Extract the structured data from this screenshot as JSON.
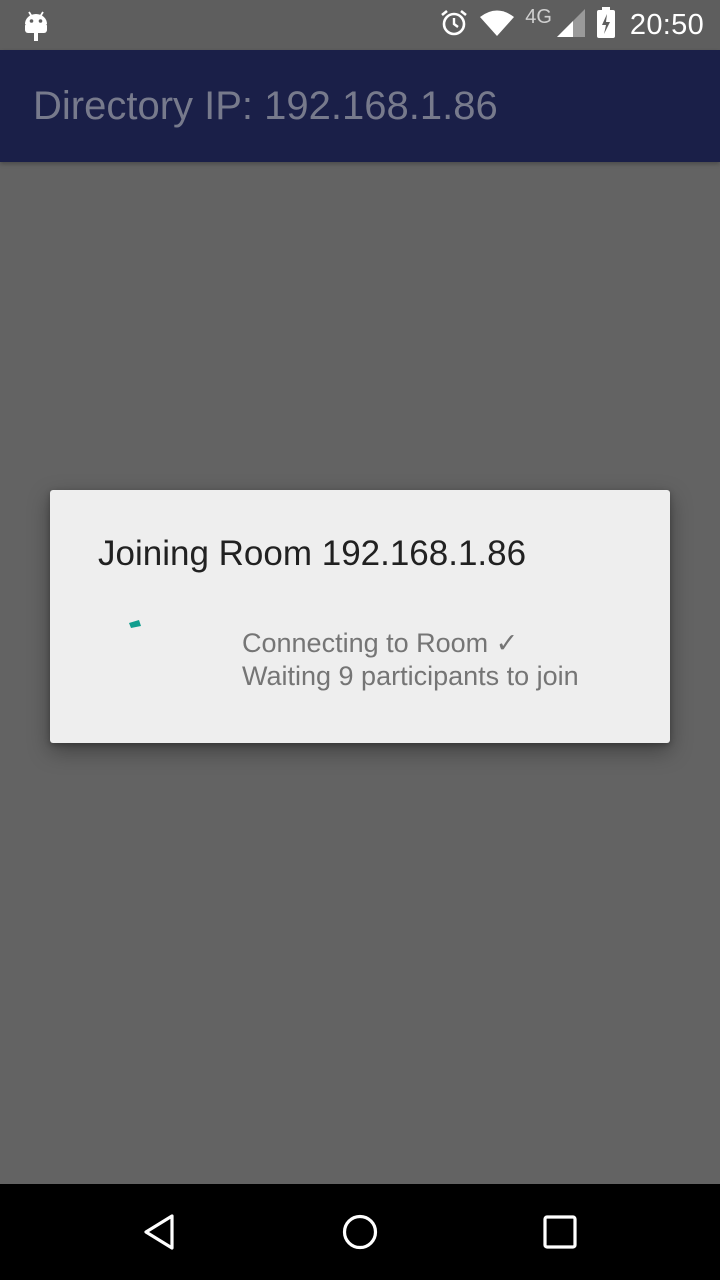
{
  "status_bar": {
    "time": "20:50",
    "network": "4G",
    "icons": [
      "android-icon",
      "alarm-icon",
      "wifi-icon",
      "cell-signal-icon",
      "battery-charging-icon"
    ]
  },
  "app_bar": {
    "title": "Directory IP: 192.168.1.86"
  },
  "dialog": {
    "title": "Joining Room 192.168.1.86",
    "line1": "Connecting to Room ✓",
    "line2": "Waiting 9 participants to join",
    "spinner_color": "#119e8f"
  },
  "nav_bar": {
    "icons": [
      "back-icon",
      "home-icon",
      "recents-icon"
    ]
  },
  "colors": {
    "app_bar": "#1a1f48",
    "scrim": "#636363",
    "dialog": "#eeeeee"
  }
}
